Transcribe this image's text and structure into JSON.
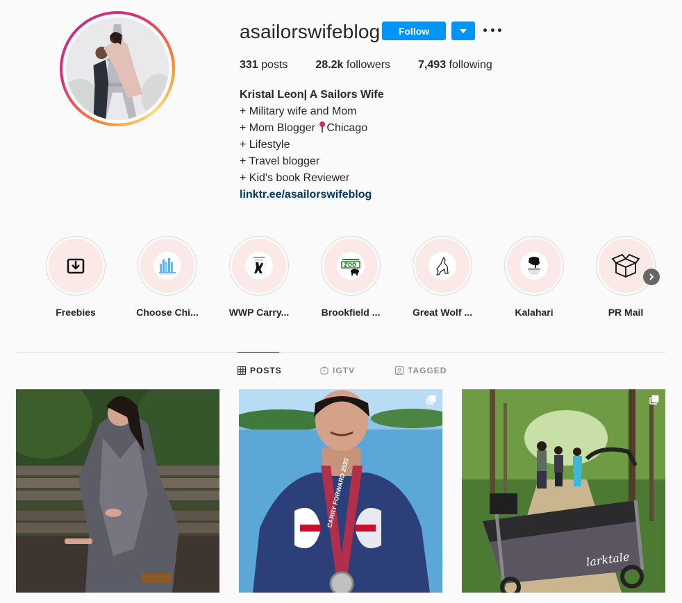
{
  "profile": {
    "username": "asailorswifeblog",
    "follow_label": "Follow",
    "stats": {
      "posts_count": "331",
      "posts_label": "posts",
      "followers_count": "28.2k",
      "followers_label": "followers",
      "following_count": "7,493",
      "following_label": "following"
    },
    "bio": {
      "name": "Kristal Leon| A Sailors Wife",
      "line1": "+ Military wife and Mom",
      "line2_pre": "+ Mom Blogger ",
      "line2_post": "Chicago",
      "line3": "+ Lifestyle",
      "line4": "+ Travel blogger",
      "line5": "+ Kid's book Reviewer",
      "link": "linktr.ee/asailorswifeblog"
    }
  },
  "highlights": [
    {
      "label": "Freebies",
      "icon": "download-box-icon"
    },
    {
      "label": "Choose Chi...",
      "icon": "chicago-skyline-logo"
    },
    {
      "label": "WWP Carry...",
      "icon": "wounded-warrior-logo"
    },
    {
      "label": "Brookfield ...",
      "icon": "brookfield-zoo-logo"
    },
    {
      "label": "Great Wolf ...",
      "icon": "howling-wolf-logo"
    },
    {
      "label": "Kalahari",
      "icon": "kalahari-elephant-logo"
    },
    {
      "label": "PR Mail",
      "icon": "open-box-icon"
    }
  ],
  "tabs": [
    {
      "label": "POSTS",
      "icon": "grid-icon",
      "active": true
    },
    {
      "label": "IGTV",
      "icon": "igtv-icon",
      "active": false
    },
    {
      "label": "TAGGED",
      "icon": "tagged-icon",
      "active": false
    }
  ],
  "posts": [
    {
      "subject": "woman in floral dress on park bench",
      "multi": false
    },
    {
      "subject": "woman with CARRY FORWARD 2020 medal",
      "multi": true
    },
    {
      "subject": "kids on forest trail with wagon",
      "multi": true
    }
  ],
  "medal_text": "CARRY FORWARD 2020",
  "wagon_brand": "larktale",
  "colors": {
    "follow_blue": "#0095f6",
    "link_blue": "#00376b",
    "text": "#262626",
    "muted": "#8e8e8e",
    "highlight_bg": "#fbe9e7"
  }
}
